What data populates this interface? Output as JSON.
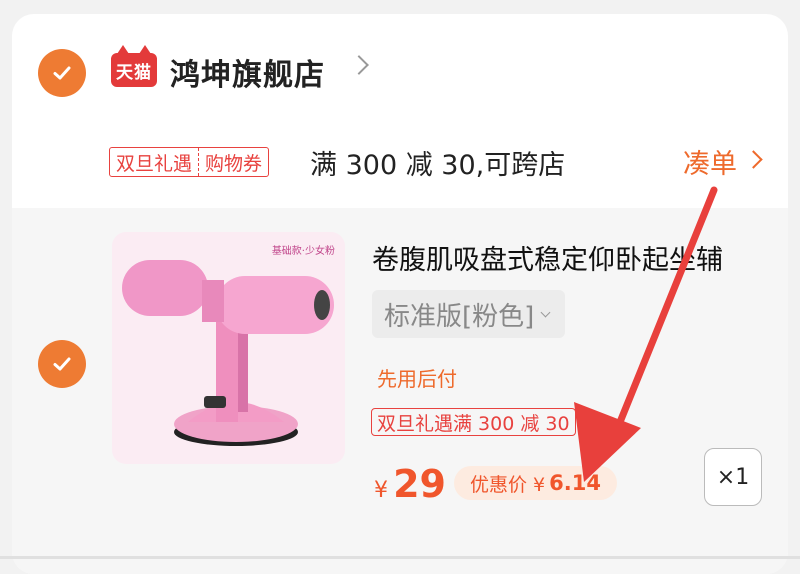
{
  "store": {
    "platform_badge": "天猫",
    "name": "鸿坤旗舰店"
  },
  "promotion": {
    "coupon_left": "双旦礼遇",
    "coupon_right": "购物券",
    "text": "满 300 减 30,可跨店",
    "combine_label": "凑单"
  },
  "product": {
    "image_tag": "基础款·少女粉",
    "title": "卷腹肌吸盘式稳定仰卧起坐辅",
    "variant": "标准版[粉色]",
    "pay_later": "先用后付",
    "promo_badge": "双旦礼遇满 300 减 30",
    "currency": "¥",
    "price": "29",
    "discount_label": "优惠价 ¥",
    "discount_value": "6.14",
    "quantity": "×1"
  },
  "colors": {
    "accent": "#ee7b33",
    "price": "#f0562c",
    "promo_red": "#e8423f",
    "annotation_arrow": "#e8403c"
  }
}
